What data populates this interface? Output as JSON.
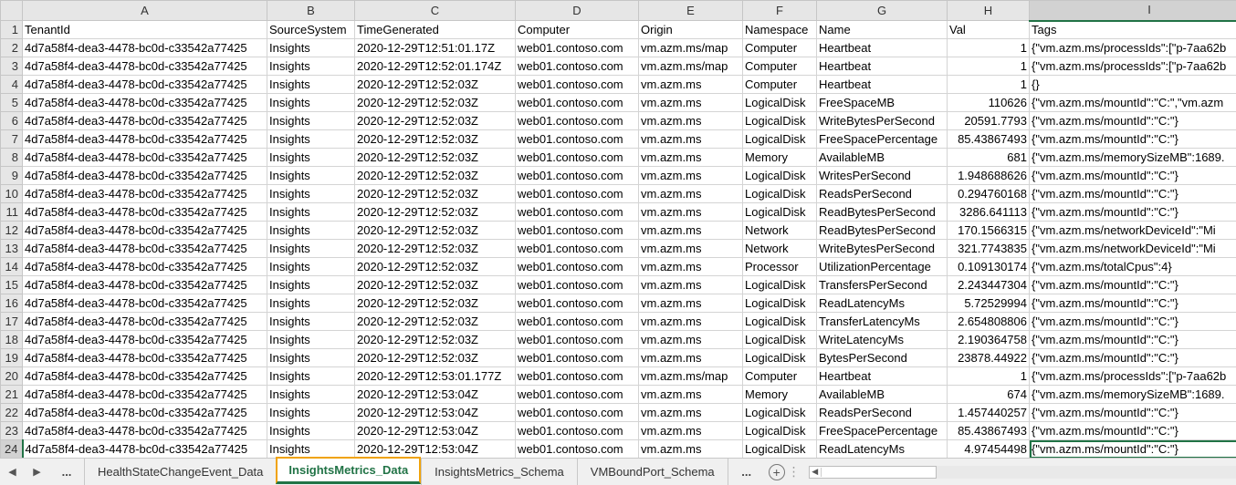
{
  "columns": [
    "A",
    "B",
    "C",
    "D",
    "E",
    "F",
    "G",
    "H",
    "I"
  ],
  "header_row": [
    "TenantId",
    "SourceSystem",
    "TimeGenerated",
    "Computer",
    "Origin",
    "Namespace",
    "Name",
    "Val",
    "Tags"
  ],
  "rows": [
    [
      "4d7a58f4-dea3-4478-bc0d-c33542a77425",
      "Insights",
      "2020-12-29T12:51:01.17Z",
      "web01.contoso.com",
      "vm.azm.ms/map",
      "Computer",
      "Heartbeat",
      "1",
      "{\"vm.azm.ms/processIds\":[\"p-7aa62b"
    ],
    [
      "4d7a58f4-dea3-4478-bc0d-c33542a77425",
      "Insights",
      "2020-12-29T12:52:01.174Z",
      "web01.contoso.com",
      "vm.azm.ms/map",
      "Computer",
      "Heartbeat",
      "1",
      "{\"vm.azm.ms/processIds\":[\"p-7aa62b"
    ],
    [
      "4d7a58f4-dea3-4478-bc0d-c33542a77425",
      "Insights",
      "2020-12-29T12:52:03Z",
      "web01.contoso.com",
      "vm.azm.ms",
      "Computer",
      "Heartbeat",
      "1",
      "{}"
    ],
    [
      "4d7a58f4-dea3-4478-bc0d-c33542a77425",
      "Insights",
      "2020-12-29T12:52:03Z",
      "web01.contoso.com",
      "vm.azm.ms",
      "LogicalDisk",
      "FreeSpaceMB",
      "110626",
      "{\"vm.azm.ms/mountId\":\"C:\",\"vm.azm"
    ],
    [
      "4d7a58f4-dea3-4478-bc0d-c33542a77425",
      "Insights",
      "2020-12-29T12:52:03Z",
      "web01.contoso.com",
      "vm.azm.ms",
      "LogicalDisk",
      "WriteBytesPerSecond",
      "20591.7793",
      "{\"vm.azm.ms/mountId\":\"C:\"}"
    ],
    [
      "4d7a58f4-dea3-4478-bc0d-c33542a77425",
      "Insights",
      "2020-12-29T12:52:03Z",
      "web01.contoso.com",
      "vm.azm.ms",
      "LogicalDisk",
      "FreeSpacePercentage",
      "85.43867493",
      "{\"vm.azm.ms/mountId\":\"C:\"}"
    ],
    [
      "4d7a58f4-dea3-4478-bc0d-c33542a77425",
      "Insights",
      "2020-12-29T12:52:03Z",
      "web01.contoso.com",
      "vm.azm.ms",
      "Memory",
      "AvailableMB",
      "681",
      "{\"vm.azm.ms/memorySizeMB\":1689."
    ],
    [
      "4d7a58f4-dea3-4478-bc0d-c33542a77425",
      "Insights",
      "2020-12-29T12:52:03Z",
      "web01.contoso.com",
      "vm.azm.ms",
      "LogicalDisk",
      "WritesPerSecond",
      "1.948688626",
      "{\"vm.azm.ms/mountId\":\"C:\"}"
    ],
    [
      "4d7a58f4-dea3-4478-bc0d-c33542a77425",
      "Insights",
      "2020-12-29T12:52:03Z",
      "web01.contoso.com",
      "vm.azm.ms",
      "LogicalDisk",
      "ReadsPerSecond",
      "0.294760168",
      "{\"vm.azm.ms/mountId\":\"C:\"}"
    ],
    [
      "4d7a58f4-dea3-4478-bc0d-c33542a77425",
      "Insights",
      "2020-12-29T12:52:03Z",
      "web01.contoso.com",
      "vm.azm.ms",
      "LogicalDisk",
      "ReadBytesPerSecond",
      "3286.641113",
      "{\"vm.azm.ms/mountId\":\"C:\"}"
    ],
    [
      "4d7a58f4-dea3-4478-bc0d-c33542a77425",
      "Insights",
      "2020-12-29T12:52:03Z",
      "web01.contoso.com",
      "vm.azm.ms",
      "Network",
      "ReadBytesPerSecond",
      "170.1566315",
      "{\"vm.azm.ms/networkDeviceId\":\"Mi"
    ],
    [
      "4d7a58f4-dea3-4478-bc0d-c33542a77425",
      "Insights",
      "2020-12-29T12:52:03Z",
      "web01.contoso.com",
      "vm.azm.ms",
      "Network",
      "WriteBytesPerSecond",
      "321.7743835",
      "{\"vm.azm.ms/networkDeviceId\":\"Mi"
    ],
    [
      "4d7a58f4-dea3-4478-bc0d-c33542a77425",
      "Insights",
      "2020-12-29T12:52:03Z",
      "web01.contoso.com",
      "vm.azm.ms",
      "Processor",
      "UtilizationPercentage",
      "0.109130174",
      "{\"vm.azm.ms/totalCpus\":4}"
    ],
    [
      "4d7a58f4-dea3-4478-bc0d-c33542a77425",
      "Insights",
      "2020-12-29T12:52:03Z",
      "web01.contoso.com",
      "vm.azm.ms",
      "LogicalDisk",
      "TransfersPerSecond",
      "2.243447304",
      "{\"vm.azm.ms/mountId\":\"C:\"}"
    ],
    [
      "4d7a58f4-dea3-4478-bc0d-c33542a77425",
      "Insights",
      "2020-12-29T12:52:03Z",
      "web01.contoso.com",
      "vm.azm.ms",
      "LogicalDisk",
      "ReadLatencyMs",
      "5.72529994",
      "{\"vm.azm.ms/mountId\":\"C:\"}"
    ],
    [
      "4d7a58f4-dea3-4478-bc0d-c33542a77425",
      "Insights",
      "2020-12-29T12:52:03Z",
      "web01.contoso.com",
      "vm.azm.ms",
      "LogicalDisk",
      "TransferLatencyMs",
      "2.654808806",
      "{\"vm.azm.ms/mountId\":\"C:\"}"
    ],
    [
      "4d7a58f4-dea3-4478-bc0d-c33542a77425",
      "Insights",
      "2020-12-29T12:52:03Z",
      "web01.contoso.com",
      "vm.azm.ms",
      "LogicalDisk",
      "WriteLatencyMs",
      "2.190364758",
      "{\"vm.azm.ms/mountId\":\"C:\"}"
    ],
    [
      "4d7a58f4-dea3-4478-bc0d-c33542a77425",
      "Insights",
      "2020-12-29T12:52:03Z",
      "web01.contoso.com",
      "vm.azm.ms",
      "LogicalDisk",
      "BytesPerSecond",
      "23878.44922",
      "{\"vm.azm.ms/mountId\":\"C:\"}"
    ],
    [
      "4d7a58f4-dea3-4478-bc0d-c33542a77425",
      "Insights",
      "2020-12-29T12:53:01.177Z",
      "web01.contoso.com",
      "vm.azm.ms/map",
      "Computer",
      "Heartbeat",
      "1",
      "{\"vm.azm.ms/processIds\":[\"p-7aa62b"
    ],
    [
      "4d7a58f4-dea3-4478-bc0d-c33542a77425",
      "Insights",
      "2020-12-29T12:53:04Z",
      "web01.contoso.com",
      "vm.azm.ms",
      "Memory",
      "AvailableMB",
      "674",
      "{\"vm.azm.ms/memorySizeMB\":1689."
    ],
    [
      "4d7a58f4-dea3-4478-bc0d-c33542a77425",
      "Insights",
      "2020-12-29T12:53:04Z",
      "web01.contoso.com",
      "vm.azm.ms",
      "LogicalDisk",
      "ReadsPerSecond",
      "1.457440257",
      "{\"vm.azm.ms/mountId\":\"C:\"}"
    ],
    [
      "4d7a58f4-dea3-4478-bc0d-c33542a77425",
      "Insights",
      "2020-12-29T12:53:04Z",
      "web01.contoso.com",
      "vm.azm.ms",
      "LogicalDisk",
      "FreeSpacePercentage",
      "85.43867493",
      "{\"vm.azm.ms/mountId\":\"C:\"}"
    ],
    [
      "4d7a58f4-dea3-4478-bc0d-c33542a77425",
      "Insights",
      "2020-12-29T12:53:04Z",
      "web01.contoso.com",
      "vm.azm.ms",
      "LogicalDisk",
      "ReadLatencyMs",
      "4.97454498",
      "{\"vm.azm.ms/mountId\":\"C:\"}"
    ]
  ],
  "sheet_tabs": {
    "nav_more": "...",
    "tabs": [
      "HealthStateChangeEvent_Data",
      "InsightsMetrics_Data",
      "InsightsMetrics_Schema",
      "VMBoundPort_Schema"
    ],
    "active_index": 1,
    "trailing_more": "...",
    "add_sheet": "+"
  },
  "colors": {
    "accent": "#217346",
    "highlight": "#f0a30a"
  }
}
